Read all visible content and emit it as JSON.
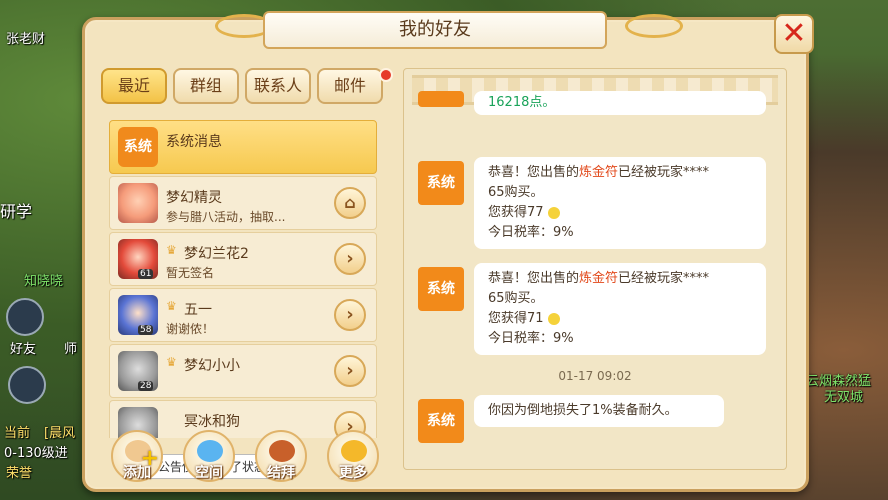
{
  "background": {
    "texts": [
      "张老财",
      "研学",
      "知晓晓",
      "好友",
      "师",
      "当前",
      "[晨风",
      "0-130级进",
      "荣誉",
      "云烟森然猛",
      "无双城"
    ]
  },
  "window": {
    "title": "我的好友",
    "close": "✕"
  },
  "tabs": [
    {
      "label": "最近",
      "active": true
    },
    {
      "label": "群组",
      "active": false
    },
    {
      "label": "联系人",
      "active": false
    },
    {
      "label": "邮件",
      "active": false,
      "badge": true
    }
  ],
  "contacts": [
    {
      "name": "系统消息",
      "sub": "",
      "avatar": "系统"
    },
    {
      "name": "梦幻精灵",
      "sub": "参与腊八活动，抽取...",
      "action": "home-icon"
    },
    {
      "name": "梦幻兰花2",
      "sub": "暂无签名",
      "level": "61",
      "action": "arrow-right-icon"
    },
    {
      "name": "五一",
      "sub": "谢谢侬！",
      "level": "58",
      "action": "arrow-right-icon"
    },
    {
      "name": "梦幻小小",
      "sub": "",
      "level": "28",
      "action": "arrow-right-icon"
    },
    {
      "name": "冥冰和狗",
      "sub": "",
      "action": "arrow-right-icon"
    }
  ],
  "tooltip": "维护公告使者更新了状态",
  "bottom_buttons": [
    {
      "label": "添加",
      "icon": "add-friend-icon"
    },
    {
      "label": "空间",
      "icon": "space-icon"
    },
    {
      "label": "结拜",
      "icon": "sworn-icon"
    },
    {
      "label": "更多",
      "icon": "more-icon"
    }
  ],
  "messages": {
    "top_partial": "16218点。",
    "items": [
      {
        "sender": "系统",
        "line1_a": "恭喜！您出售的",
        "line1_hl": "炼金符",
        "line1_b": "已经被玩家****",
        "line2": "65购买。",
        "line3": "您获得77",
        "line4": "今日税率：9%"
      },
      {
        "sender": "系统",
        "line1_a": "恭喜！您出售的",
        "line1_hl": "炼金符",
        "line1_b": "已经被玩家****",
        "line2": "65购买。",
        "line3": "您获得71",
        "line4": "今日税率：9%"
      }
    ],
    "timestamp": "01-17  09:02",
    "last": {
      "sender": "系统",
      "text": "你因为倒地损失了1%装备耐久。"
    }
  },
  "colors": {
    "accent": "#f3c247",
    "system": "#f28a1a",
    "highlight": "#e24a1c",
    "close": "#d6271b"
  }
}
